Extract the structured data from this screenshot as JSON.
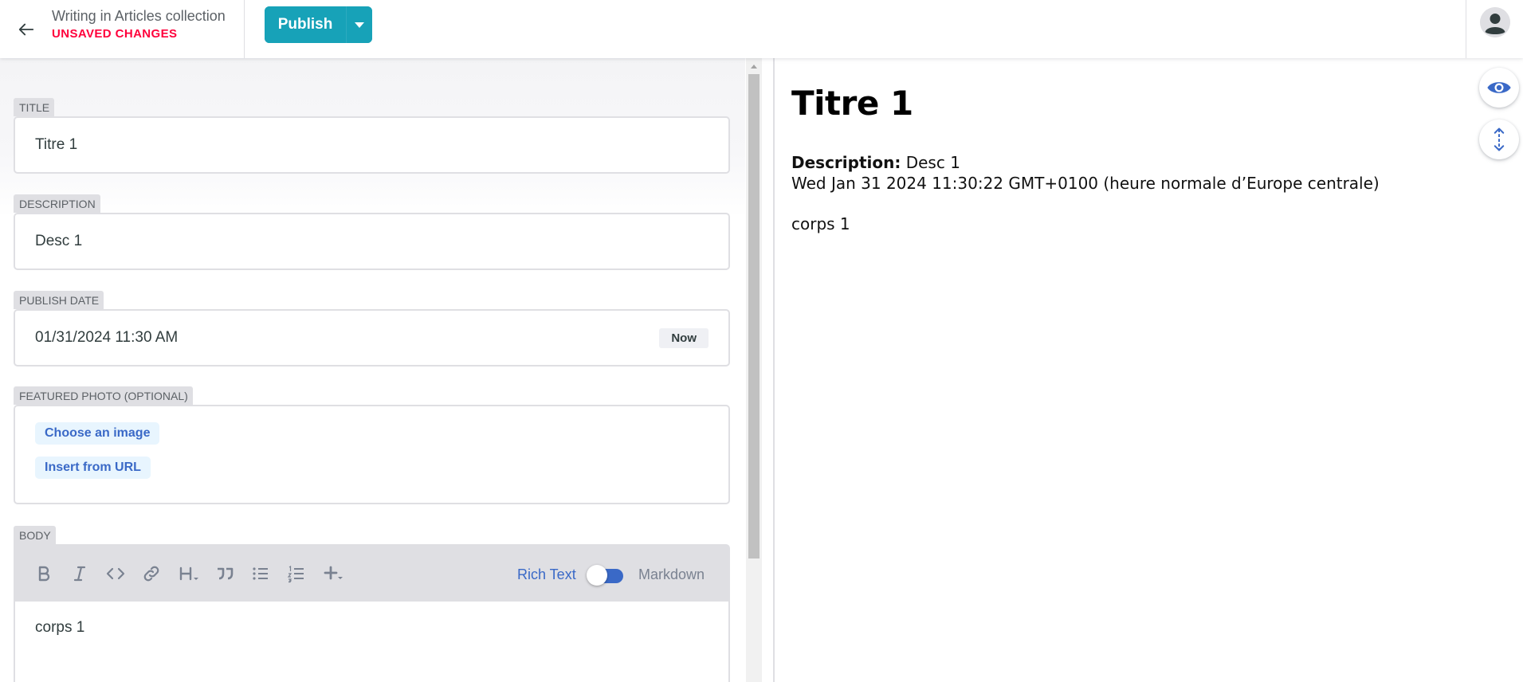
{
  "topbar": {
    "back_icon": "arrow-left-icon",
    "title": "Writing in Articles collection",
    "status": "UNSAVED CHANGES",
    "publish_label": "Publish",
    "accent_color": "#17a2b8",
    "status_color": "#ff003b"
  },
  "editor": {
    "fields": {
      "title": {
        "label": "TITLE",
        "value": "Titre 1"
      },
      "description": {
        "label": "DESCRIPTION",
        "value": "Desc 1"
      },
      "publish_date": {
        "label": "PUBLISH DATE",
        "value": "01/31/2024 11:30 AM",
        "now_label": "Now"
      },
      "featured_photo": {
        "label": "FEATURED PHOTO (OPTIONAL)",
        "choose_label": "Choose an image",
        "url_label": "Insert from URL"
      },
      "body": {
        "label": "BODY",
        "toolbar": [
          "bold-icon",
          "italic-icon",
          "code-icon",
          "link-icon",
          "heading-icon",
          "quote-icon",
          "bulleted-list-icon",
          "numbered-list-icon",
          "add-component-icon"
        ],
        "rich_text_label": "Rich Text",
        "markdown_label": "Markdown",
        "mode": "Rich Text",
        "content": "corps 1"
      }
    }
  },
  "preview": {
    "title": "Titre 1",
    "description_label": "Description:",
    "description_value": "Desc 1",
    "date": "Wed Jan 31 2024 11:30:22 GMT+0100 (heure normale d’Europe centrale)",
    "body": "corps 1",
    "controls": [
      "eye-icon",
      "scroll-sync-icon"
    ]
  }
}
